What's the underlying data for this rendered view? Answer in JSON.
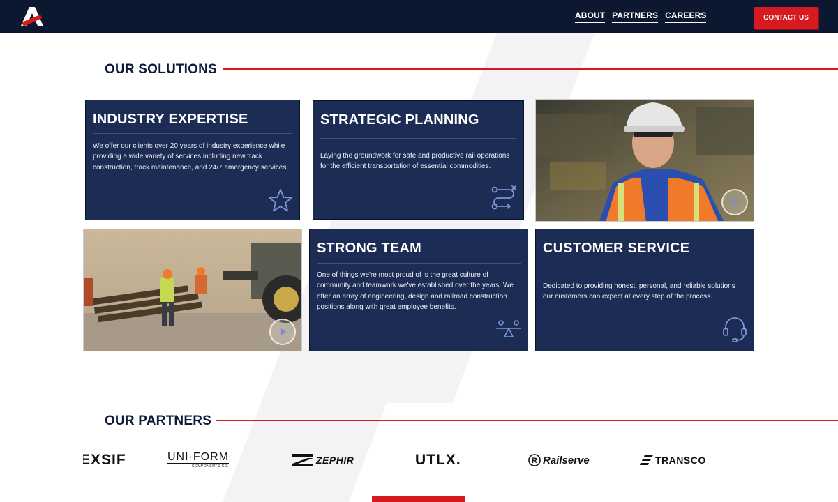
{
  "header": {
    "logo_name": "logo-icon",
    "nav": [
      {
        "label": "ABOUT"
      },
      {
        "label": "PARTNERS"
      },
      {
        "label": "CAREERS"
      }
    ],
    "contact_label": "CONTACT US"
  },
  "solutions": {
    "title": "OUR SOLUTIONS",
    "cards": [
      {
        "title": "INDUSTRY EXPERTISE",
        "text": "We offer our clients over 20 years of industry experience while providing a wide variety of services including new track construction, track maintenance, and 24/7 emergency services.",
        "icon": "star-icon"
      },
      {
        "title": "STRATEGIC PLANNING",
        "text": "Laying the groundwork for safe and productive rail operations for the efficient transportation of essential commodities.",
        "icon": "route-icon"
      },
      {
        "title": "STRONG TEAM",
        "text": "One of things we're most proud of is the great culture of community and teamwork we've established over the years. We offer an array of engineering, design and railroad construction positions along with great employee benefits.",
        "icon": "balance-icon"
      },
      {
        "title": "CUSTOMER SERVICE",
        "text": "Dedicated to providing honest, personal, and reliable solutions our customers can expect at every step of the process.",
        "icon": "headset-icon"
      }
    ]
  },
  "partners": {
    "title": "OUR PARTNERS",
    "logos": [
      {
        "text": "EXSIF"
      },
      {
        "text": "UNI·FORM",
        "subtext": "COMPONENTS CO."
      },
      {
        "text": "ZEPHIR"
      },
      {
        "text": "UTLX."
      },
      {
        "text": "Railserve"
      },
      {
        "text": "TRANSCO"
      }
    ]
  },
  "colors": {
    "navy": "#0c1730",
    "card": "#1c2c55",
    "accent": "#d71920"
  }
}
